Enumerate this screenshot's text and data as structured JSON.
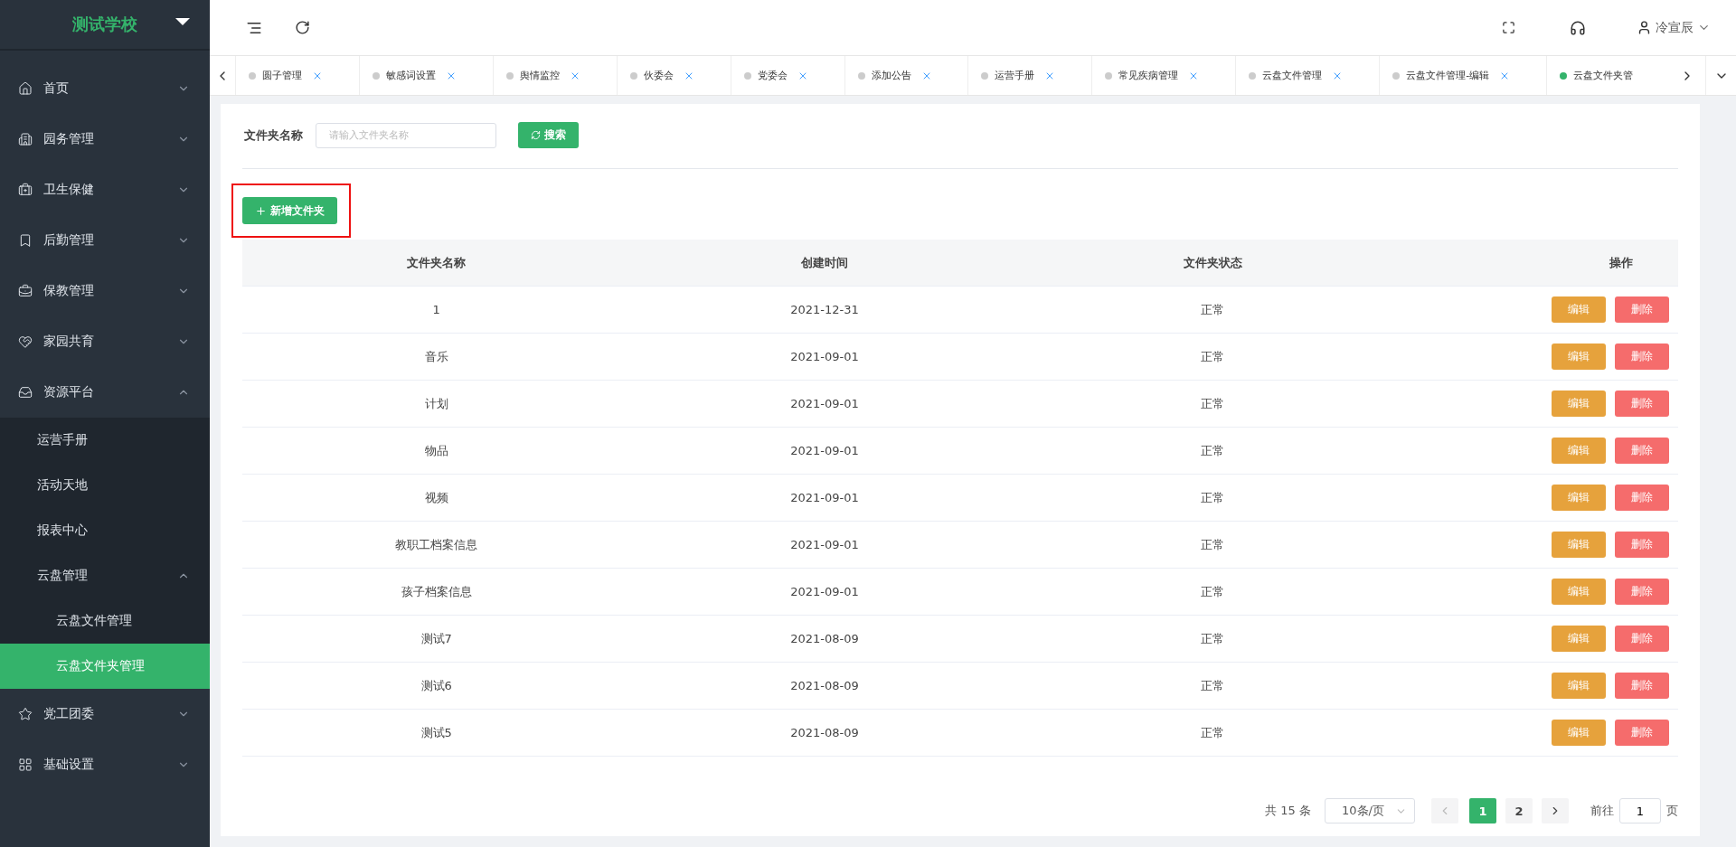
{
  "brand": {
    "title": "测试学校"
  },
  "sidebar": {
    "items": [
      {
        "label": "首页",
        "expanded": false
      },
      {
        "label": "园务管理",
        "expanded": false
      },
      {
        "label": "卫生保健",
        "expanded": false
      },
      {
        "label": "后勤管理",
        "expanded": false
      },
      {
        "label": "保教管理",
        "expanded": false
      },
      {
        "label": "家园共育",
        "expanded": false
      },
      {
        "label": "资源平台",
        "expanded": true,
        "children": [
          {
            "label": "运营手册",
            "selected": false
          },
          {
            "label": "活动天地",
            "selected": false
          },
          {
            "label": "报表中心",
            "selected": false
          },
          {
            "label": "云盘管理",
            "expanded": true,
            "selected": false,
            "children": [
              {
                "label": "云盘文件管理",
                "selected": false
              },
              {
                "label": "云盘文件夹管理",
                "selected": true
              }
            ]
          }
        ]
      },
      {
        "label": "党工团委",
        "expanded": false
      },
      {
        "label": "基础设置",
        "expanded": false
      }
    ]
  },
  "header": {
    "user": "冷宣辰"
  },
  "tabs": [
    {
      "label": "圆子管理",
      "selected": false,
      "closable": true
    },
    {
      "label": "敏感词设置",
      "selected": false,
      "closable": true
    },
    {
      "label": "舆情监控",
      "selected": false,
      "closable": true
    },
    {
      "label": "伙委会",
      "selected": false,
      "closable": true
    },
    {
      "label": "党委会",
      "selected": false,
      "closable": true
    },
    {
      "label": "添加公告",
      "selected": false,
      "closable": true
    },
    {
      "label": "运营手册",
      "selected": false,
      "closable": true
    },
    {
      "label": "常见疾病管理",
      "selected": false,
      "closable": true
    },
    {
      "label": "云盘文件管理",
      "selected": false,
      "closable": true
    },
    {
      "label": "云盘文件管理-编辑",
      "selected": false,
      "closable": true
    },
    {
      "label": "云盘文件夹管",
      "selected": true,
      "closable": false
    }
  ],
  "filter": {
    "label": "文件夹名称",
    "placeholder": "请输入文件夹名称",
    "search_button": "搜索"
  },
  "add_button": {
    "label": "新增文件夹",
    "highlighted": true
  },
  "table": {
    "columns": [
      "文件夹名称",
      "创建时间",
      "文件夹状态",
      "操作"
    ],
    "rows": [
      {
        "name": "1",
        "created": "2021-12-31",
        "status": "正常",
        "edit": "编辑",
        "delete": "删除"
      },
      {
        "name": "音乐",
        "created": "2021-09-01",
        "status": "正常",
        "edit": "编辑",
        "delete": "删除"
      },
      {
        "name": "计划",
        "created": "2021-09-01",
        "status": "正常",
        "edit": "编辑",
        "delete": "删除"
      },
      {
        "name": "物品",
        "created": "2021-09-01",
        "status": "正常",
        "edit": "编辑",
        "delete": "删除"
      },
      {
        "name": "视频",
        "created": "2021-09-01",
        "status": "正常",
        "edit": "编辑",
        "delete": "删除"
      },
      {
        "name": "教职工档案信息",
        "created": "2021-09-01",
        "status": "正常",
        "edit": "编辑",
        "delete": "删除"
      },
      {
        "name": "孩子档案信息",
        "created": "2021-09-01",
        "status": "正常",
        "edit": "编辑",
        "delete": "删除"
      },
      {
        "name": "测试7",
        "created": "2021-08-09",
        "status": "正常",
        "edit": "编辑",
        "delete": "删除"
      },
      {
        "name": "测试6",
        "created": "2021-08-09",
        "status": "正常",
        "edit": "编辑",
        "delete": "删除"
      },
      {
        "name": "测试5",
        "created": "2021-08-09",
        "status": "正常",
        "edit": "编辑",
        "delete": "删除"
      }
    ]
  },
  "pagination": {
    "total": "共 15 条",
    "page_size": "10条/页",
    "pages": [
      {
        "label": "1",
        "selected": true
      },
      {
        "label": "2",
        "selected": false
      }
    ],
    "goto_label": "前往",
    "goto_value": "1",
    "goto_suffix": "页"
  }
}
